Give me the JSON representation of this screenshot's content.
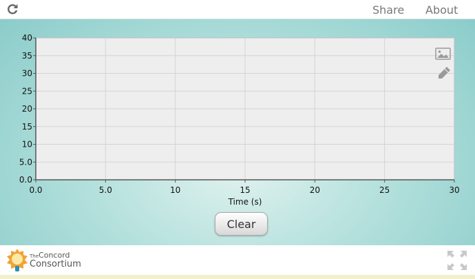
{
  "topbar": {
    "share_label": "Share",
    "about_label": "About"
  },
  "chart_data": {
    "type": "line",
    "series": [],
    "xlabel": "Time (s)",
    "ylabel": "",
    "xlim": [
      0,
      30
    ],
    "ylim": [
      0,
      40
    ],
    "x_ticks": [
      "0.0",
      "5.0",
      "10",
      "15",
      "20",
      "25",
      "30"
    ],
    "y_ticks": [
      "0.0",
      "5.0",
      "10",
      "15",
      "20",
      "25",
      "30",
      "35",
      "40"
    ],
    "grid": true
  },
  "controls": {
    "clear_label": "Clear"
  },
  "footer": {
    "logo_the": "The",
    "logo_line1": "Concord",
    "logo_line2": "Consortium"
  },
  "colors": {
    "plot_bg": "#eeeeee",
    "grid": "#d4d4d4",
    "axis": "#555555",
    "icons": "#9a9a9a"
  },
  "icons": [
    "reload-icon",
    "image-icon",
    "pencil-icon",
    "fullscreen-icon",
    "lightbulb-icon"
  ]
}
